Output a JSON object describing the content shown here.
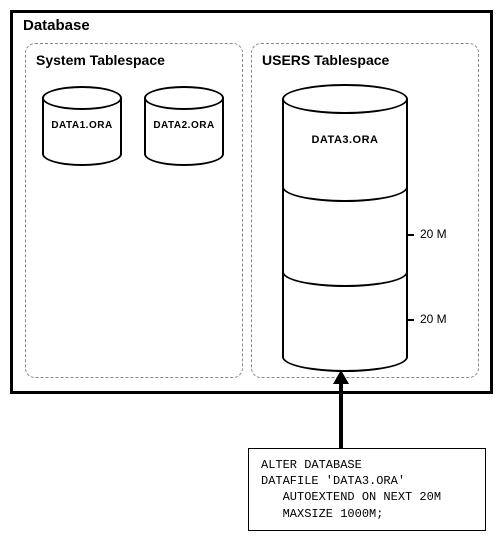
{
  "database": {
    "title": "Database"
  },
  "tablespaces": {
    "system": {
      "title": "System Tablespace",
      "files": [
        "DATA1.ORA",
        "DATA2.ORA"
      ]
    },
    "users": {
      "title": "USERS Tablespace",
      "file": "DATA3.ORA",
      "segment_sizes": [
        "20 M",
        "20 M"
      ]
    }
  },
  "sql": {
    "line1": "ALTER DATABASE",
    "line2": "DATAFILE 'DATA3.ORA'",
    "line3": "   AUTOEXTEND ON NEXT 20M",
    "line4": "   MAXSIZE 1000M;"
  }
}
